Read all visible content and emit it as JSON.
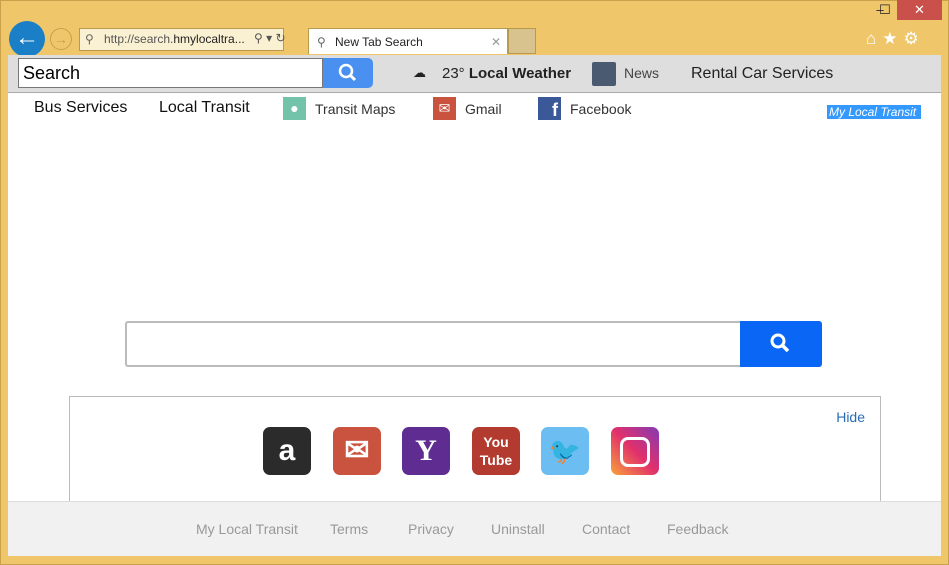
{
  "browser": {
    "url_prefix": "http://search.",
    "url_host": "hmylocaltra...",
    "tab_title": "New Tab Search",
    "window_close": "✕",
    "window_min": "–",
    "window_max": "☐"
  },
  "toolbar": {
    "search_value": "Search",
    "weather_temp": "23°",
    "weather_label": "Local Weather",
    "news": "News",
    "rental": "Rental Car Services"
  },
  "nav": {
    "bus": "Bus Services",
    "local": "Local Transit",
    "maps": "Transit Maps",
    "gmail": "Gmail",
    "facebook": "Facebook",
    "brand": "My Local Transit"
  },
  "main": {
    "search_value": "",
    "hide": "Hide"
  },
  "shortcuts": [
    {
      "name": "Amazon",
      "color": "#2b2b2b"
    },
    {
      "name": "Gmail",
      "color": "#c9533f"
    },
    {
      "name": "Yahoo",
      "color": "#5f2d91"
    },
    {
      "name": "YouTube",
      "color": "#b33a2e"
    },
    {
      "name": "Twitter",
      "color": "#6cbef2"
    },
    {
      "name": "Instagram",
      "color": "#c13584"
    }
  ],
  "footer": [
    "My Local Transit",
    "Terms",
    "Privacy",
    "Uninstall",
    "Contact",
    "Feedback"
  ]
}
